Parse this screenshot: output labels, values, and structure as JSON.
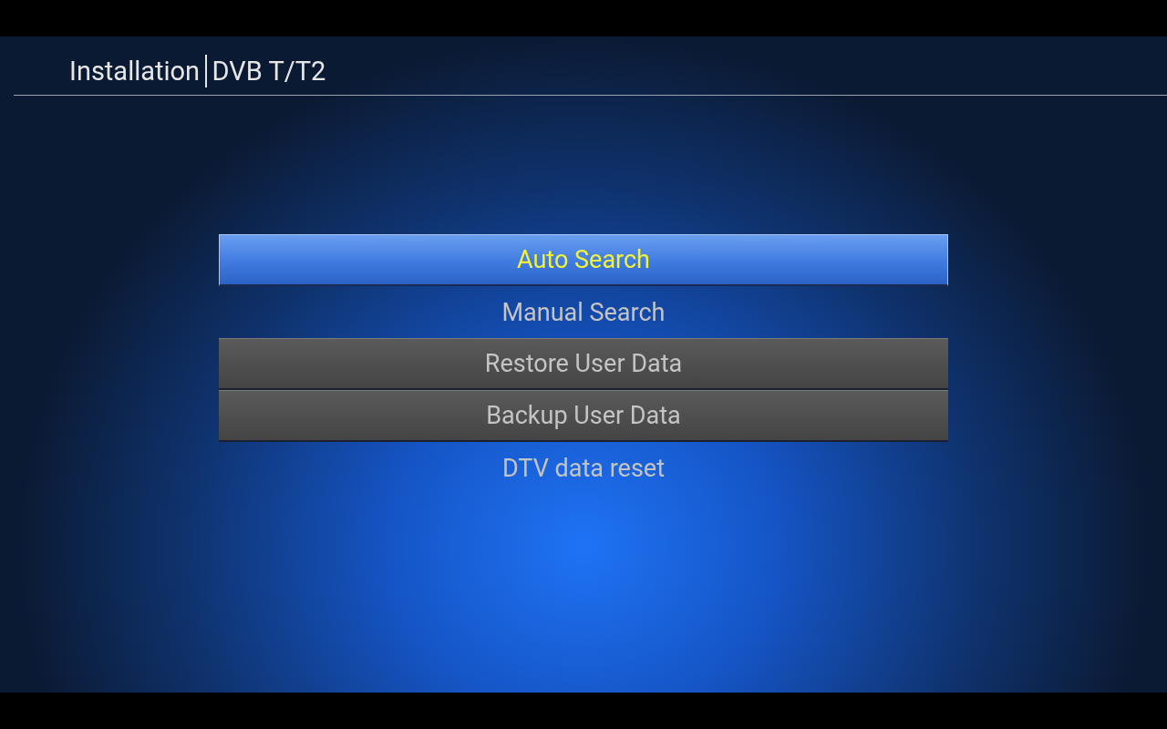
{
  "header": {
    "title": "Installation",
    "subtitle": "DVB T/T2"
  },
  "menu": [
    {
      "label": "Auto Search",
      "selected": true,
      "kind": "plain"
    },
    {
      "label": "Manual Search",
      "selected": false,
      "kind": "plain"
    },
    {
      "label": "Restore User Data",
      "selected": false,
      "kind": "panel"
    },
    {
      "label": "Backup User Data",
      "selected": false,
      "kind": "panel"
    },
    {
      "label": "DTV data reset",
      "selected": false,
      "kind": "plain"
    }
  ]
}
